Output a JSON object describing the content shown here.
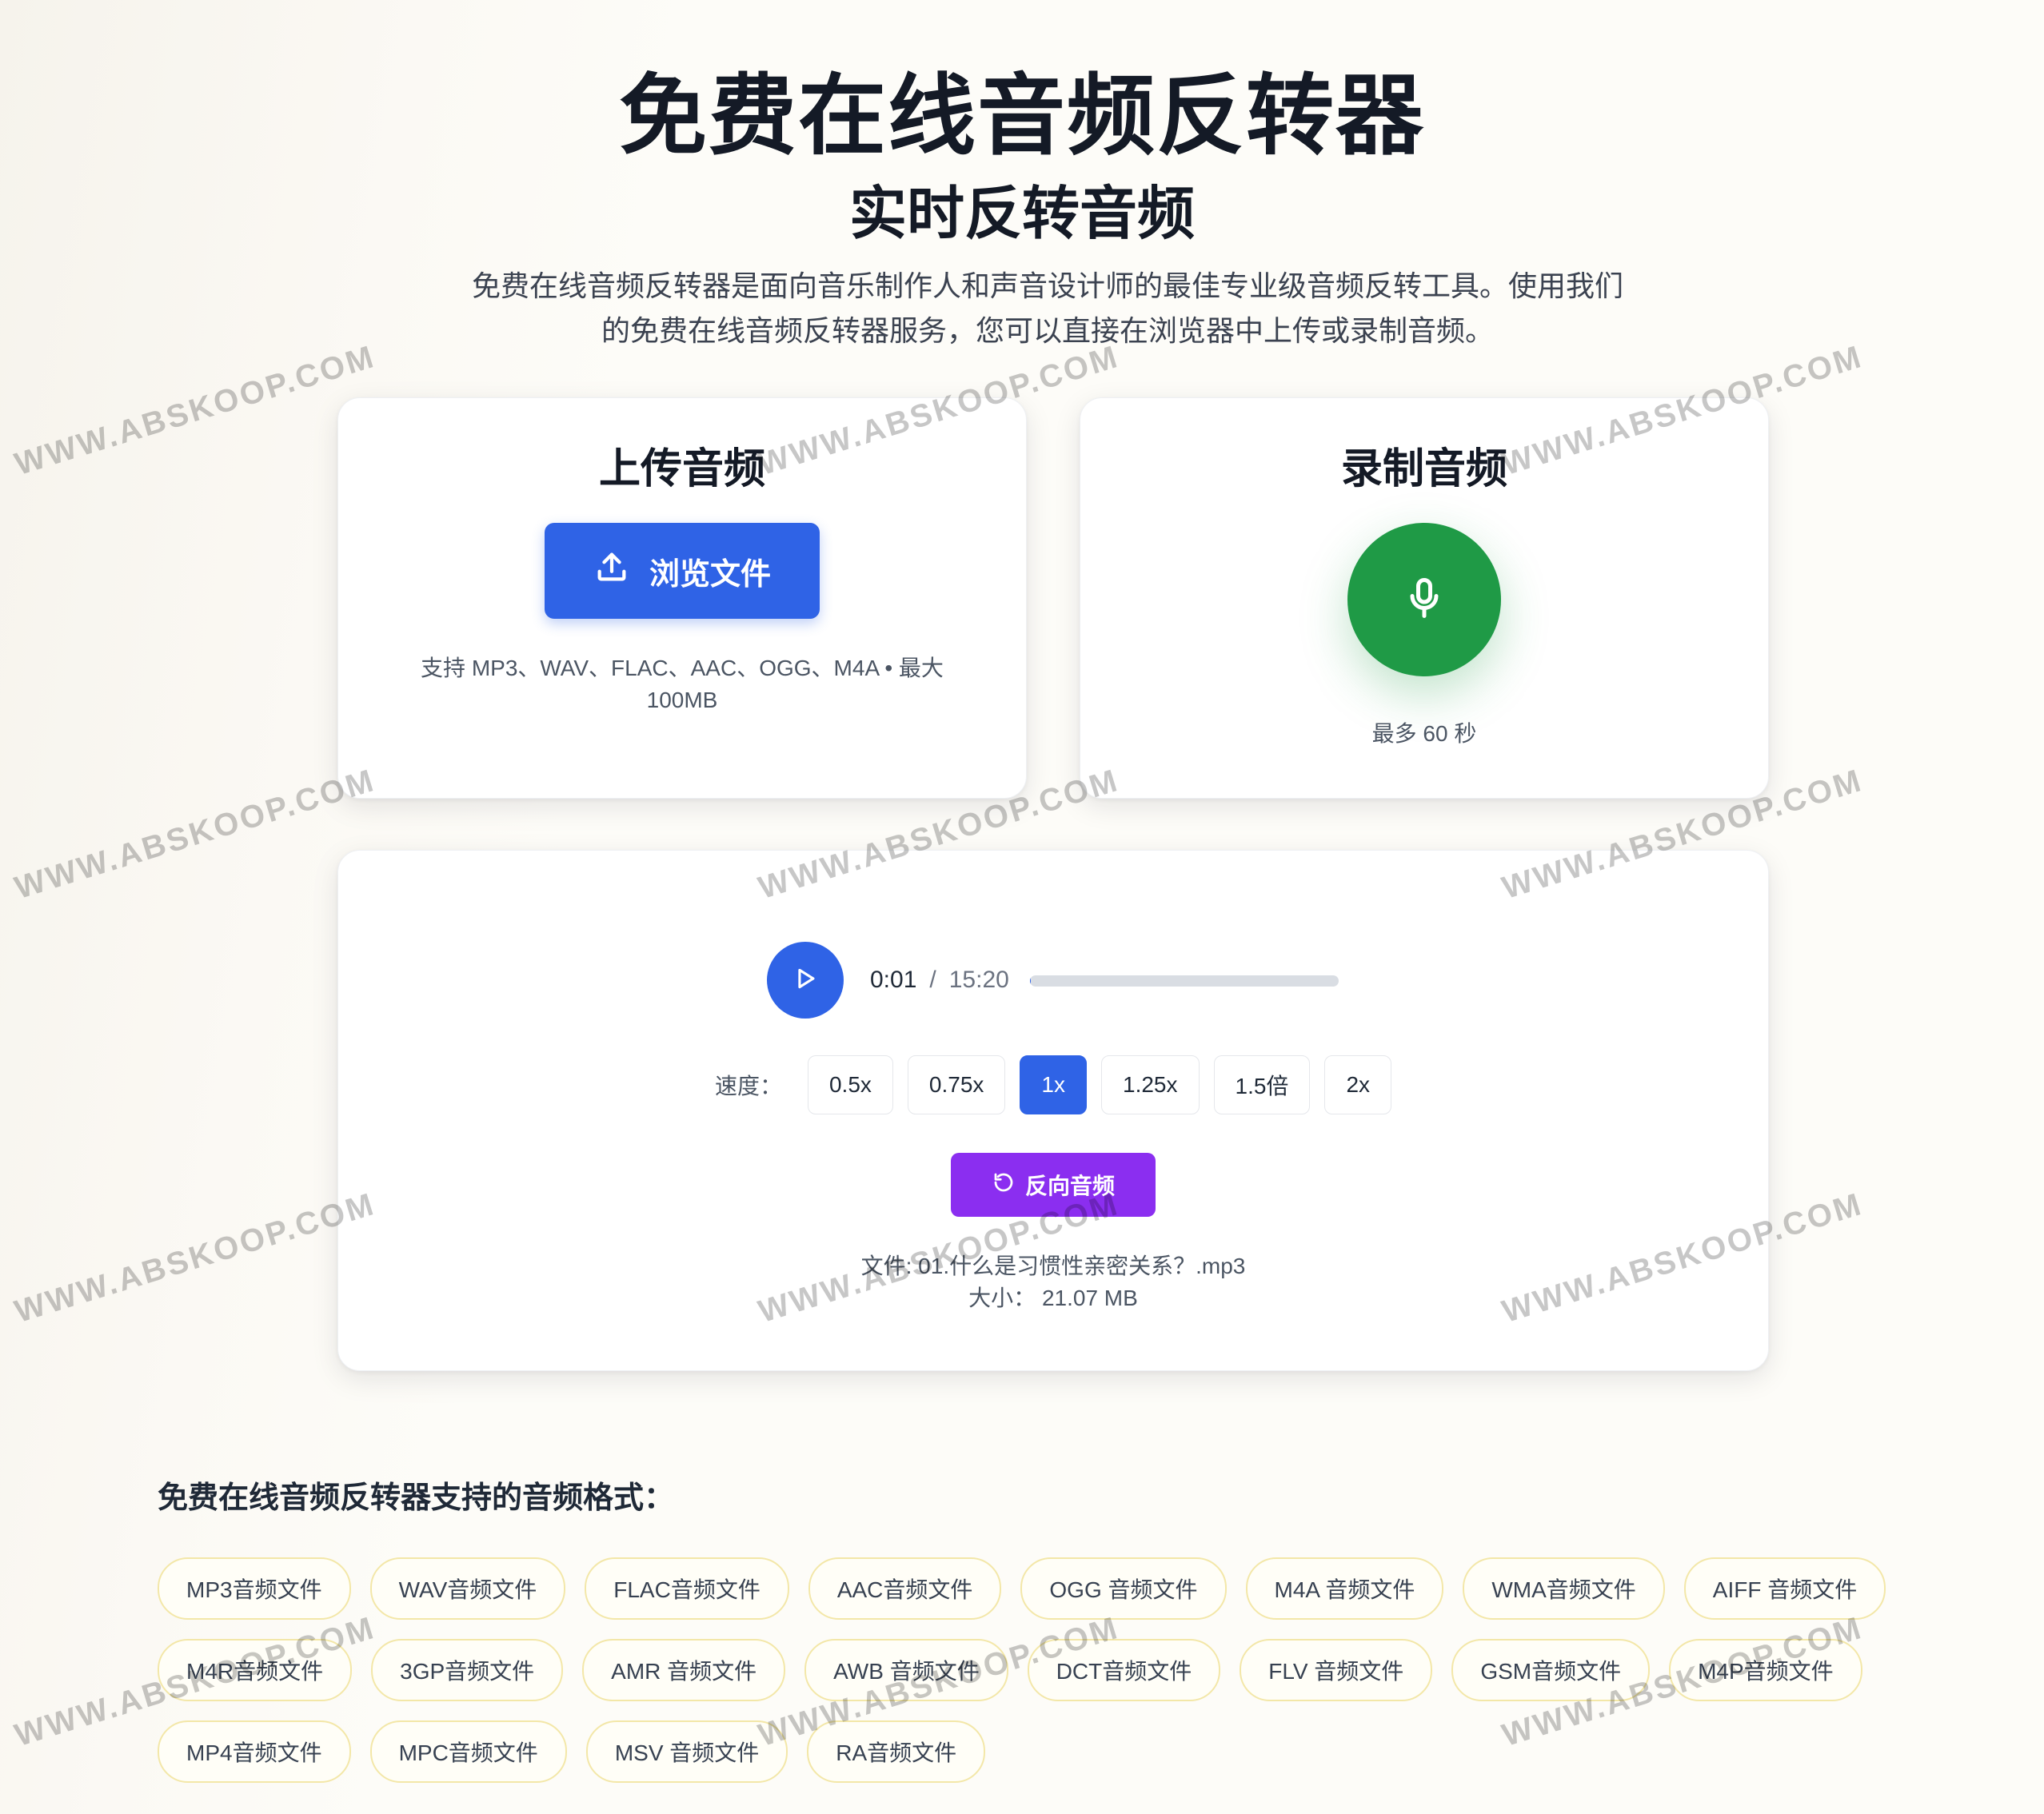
{
  "header": {
    "title": "免费在线音频反转器",
    "subtitle": "实时反转音频",
    "intro_line1": "免费在线音频反转器是面向音乐制作人和声音设计师的最佳专业级音频反转工具。使用我们",
    "intro_line2": "的免费在线音频反转器服务，您可以直接在浏览器中上传或录制音频。"
  },
  "upload": {
    "title": "上传音频",
    "browse_label": "浏览文件",
    "note_line1": "支持 MP3、WAV、FLAC、AAC、OGG、M4A • 最大",
    "note_line2": "100MB",
    "icon": "upload-icon"
  },
  "record": {
    "title": "录制音频",
    "note": "最多 60 秒",
    "icon": "microphone-icon"
  },
  "player": {
    "current_time": "0:01",
    "separator": "/",
    "duration": "15:20",
    "progress_fraction": 0.001,
    "speed_label": "速度：",
    "speeds": [
      "0.5x",
      "0.75x",
      "1x",
      "1.25x",
      "1.5倍",
      "2x"
    ],
    "active_speed": "1x",
    "reverse_label": "反向音频",
    "file_line": "文件: 01.什么是习惯性亲密关系？.mp3",
    "size_line": "大小： 21.07 MB"
  },
  "formats": {
    "title": "免费在线音频反转器支持的音频格式：",
    "rows": [
      [
        "MP3音频文件",
        "WAV音频文件",
        "FLAC音频文件",
        "AAC音频文件",
        "OGG 音频文件",
        "M4A 音频文件",
        "WMA音频文件",
        "AIFF 音频文件"
      ],
      [
        "M4R音频文件",
        "3GP音频文件",
        "AMR 音频文件",
        "AWB 音频文件",
        "DCT音频文件",
        "FLV 音频文件",
        "GSM音频文件",
        "M4P音频文件"
      ],
      [
        "MP4音频文件",
        "MPC音频文件",
        "MSV 音频文件",
        "RA音频文件"
      ]
    ]
  },
  "watermark": "WWW.ABSKOOP.COM",
  "colors": {
    "primary": "#2f63e6",
    "record": "#1f9a46",
    "reverse": "#8b2ef0",
    "chip_border": "#f3e7a8"
  }
}
